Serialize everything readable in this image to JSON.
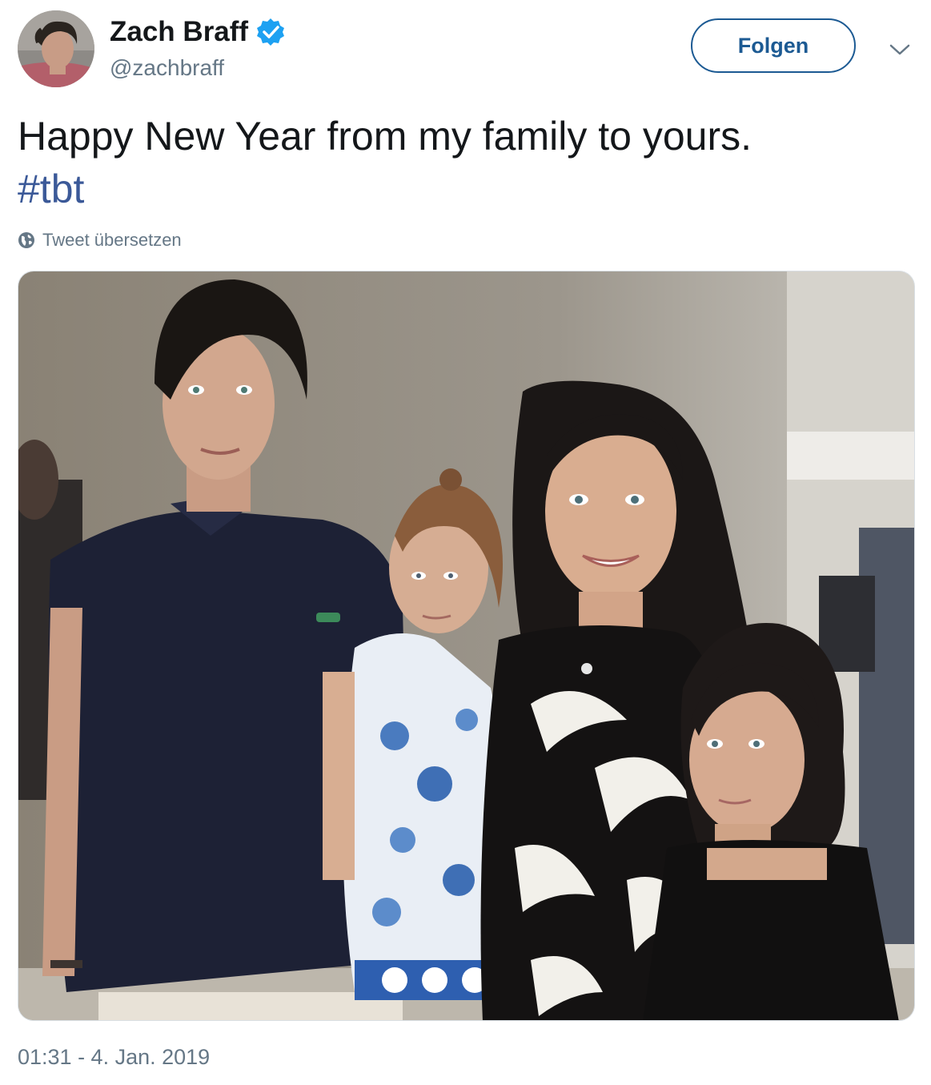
{
  "user": {
    "display_name": "Zach Braff",
    "handle": "@zachbraff",
    "avatar_icon": "profile-photo",
    "verified_icon": "verified-badge-icon"
  },
  "actions": {
    "follow_label": "Folgen",
    "more_icon": "chevron-down-icon"
  },
  "tweet": {
    "text": "Happy New Year from my family to yours.",
    "hashtag": "#tbt",
    "translate_label": "Tweet übersetzen",
    "translate_icon": "globe-icon",
    "timestamp": "01:31 - 4. Jan. 2019"
  },
  "colors": {
    "text": "#14171a",
    "secondary": "#657786",
    "link": "#3b5998",
    "follow_border": "#1c5a93",
    "verified": "#1da1f2"
  }
}
